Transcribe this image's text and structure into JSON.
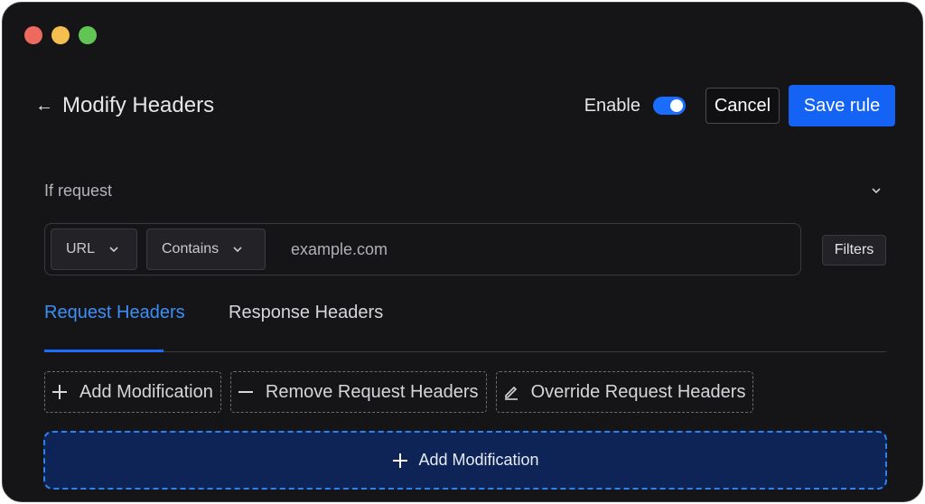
{
  "header": {
    "title": "Modify Headers",
    "enable_label": "Enable",
    "enabled": true,
    "cancel_label": "Cancel",
    "save_label": "Save rule"
  },
  "condition": {
    "label": "If request",
    "field_select": "URL",
    "operator_select": "Contains",
    "value": "example.com",
    "filters_label": "Filters"
  },
  "tabs": [
    {
      "label": "Request Headers",
      "active": true
    },
    {
      "label": "Response Headers",
      "active": false
    }
  ],
  "actions": [
    {
      "label": "Add Modification",
      "icon": "plus-icon"
    },
    {
      "label": "Remove Request Headers",
      "icon": "minus-icon"
    },
    {
      "label": "Override Request Headers",
      "icon": "pencil-icon"
    }
  ],
  "add_modification_label": "Add Modification",
  "colors": {
    "accent": "#1a6dfe",
    "background": "#151518",
    "add_area": "#0e2456"
  }
}
